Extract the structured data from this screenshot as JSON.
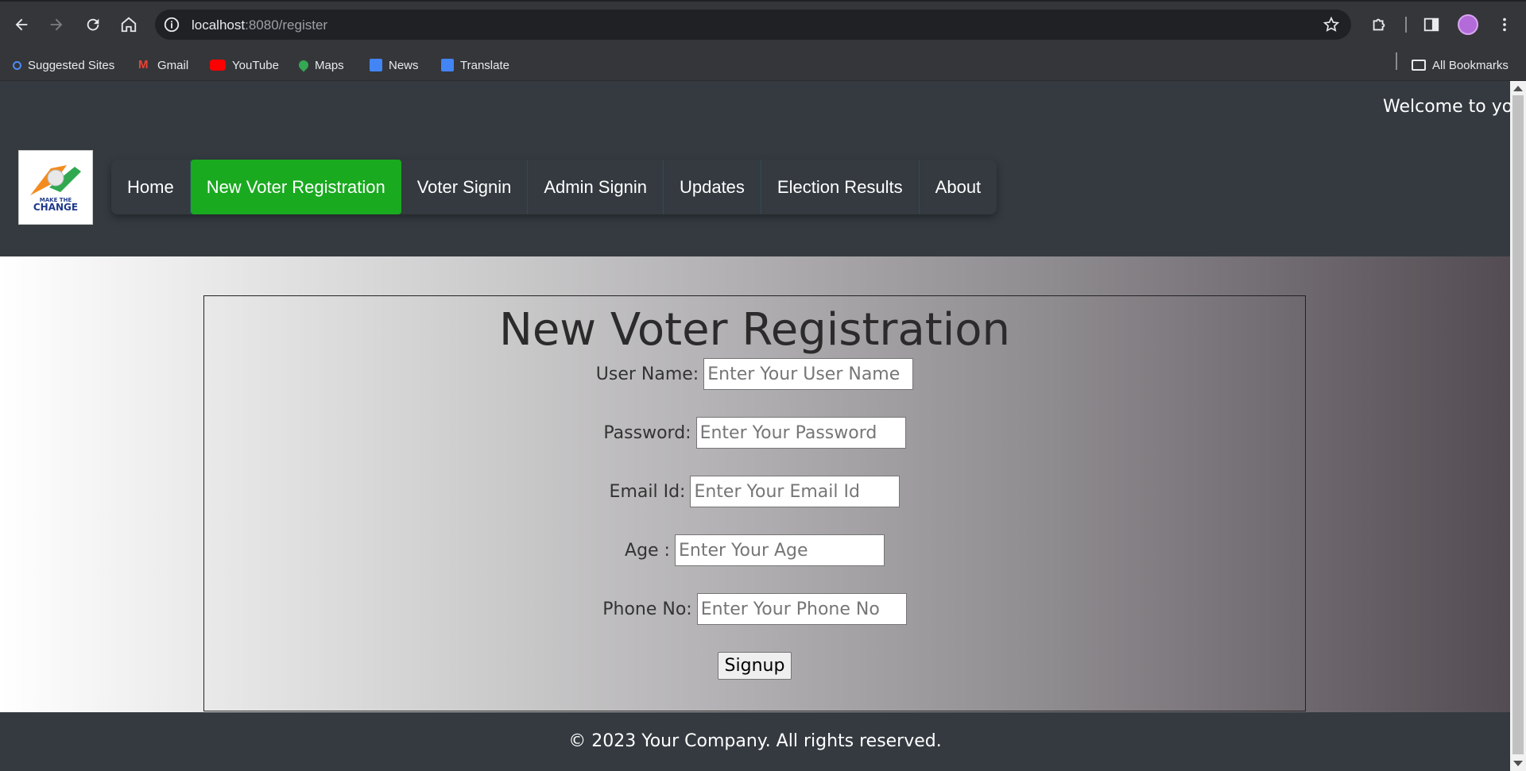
{
  "browser": {
    "url_host": "localhost",
    "url_rest": ":8080/register",
    "bookmarks": [
      {
        "label": "Suggested Sites",
        "icon": "search-icon"
      },
      {
        "label": "Gmail",
        "icon": "gmail-icon"
      },
      {
        "label": "YouTube",
        "icon": "youtube-icon"
      },
      {
        "label": "Maps",
        "icon": "maps-icon"
      },
      {
        "label": "News",
        "icon": "news-icon"
      },
      {
        "label": "Translate",
        "icon": "translate-icon"
      }
    ],
    "all_bookmarks": "All Bookmarks"
  },
  "header": {
    "marquee": "Welcome to yo",
    "logo_text": "MAKE THE CHANGE"
  },
  "nav": [
    {
      "label": "Home"
    },
    {
      "label": "New Voter Registration",
      "active": true
    },
    {
      "label": "Voter Signin"
    },
    {
      "label": "Admin Signin"
    },
    {
      "label": "Updates"
    },
    {
      "label": "Election Results"
    },
    {
      "label": "About"
    }
  ],
  "form": {
    "title": "New Voter Registration",
    "fields": [
      {
        "label": "User Name:",
        "placeholder": "Enter Your User Name"
      },
      {
        "label": "Password:",
        "placeholder": "Enter Your Password"
      },
      {
        "label": "Email Id:",
        "placeholder": "Enter Your Email Id"
      },
      {
        "label": "Age :",
        "placeholder": "Enter Your Age"
      },
      {
        "label": "Phone No:",
        "placeholder": "Enter Your Phone No"
      }
    ],
    "submit": "Signup"
  },
  "footer": {
    "text": "© 2023 Your Company. All rights reserved."
  },
  "colors": {
    "nav_active": "#1aaa20",
    "header_bg": "#343a40"
  }
}
